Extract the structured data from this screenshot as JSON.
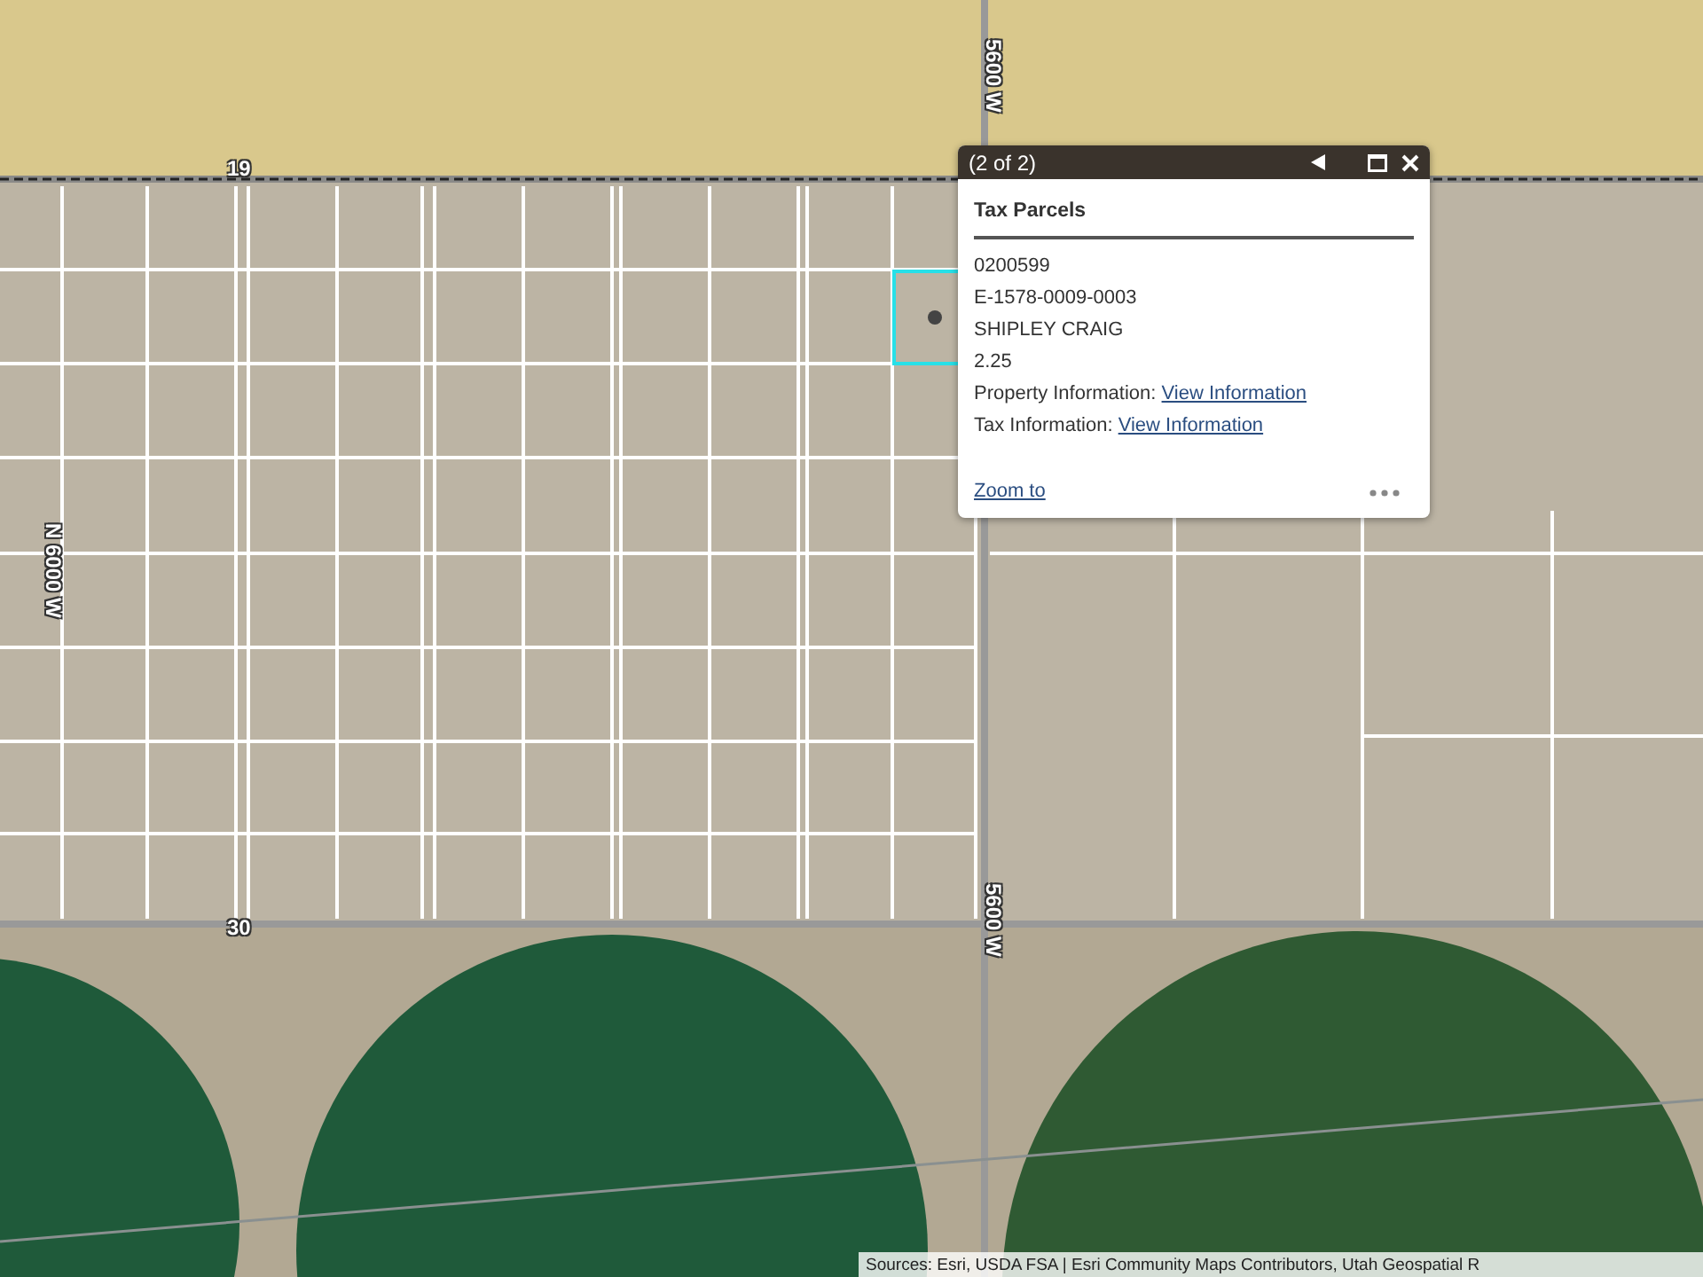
{
  "map": {
    "road_labels": [
      {
        "text": "19",
        "vertical": false
      },
      {
        "text": "5600 W",
        "vertical": true
      },
      {
        "text": "N 6000 W",
        "vertical": true
      },
      {
        "text": "30",
        "vertical": false
      },
      {
        "text": "5600 W",
        "vertical": true
      }
    ],
    "selected_parcel": true
  },
  "popup": {
    "pager": "(2 of 2)",
    "title": "Tax Parcels",
    "lines": [
      "0200599",
      "E-1578-0009-0003",
      "SHIPLEY CRAIG",
      "2.25"
    ],
    "fields": [
      {
        "label": "Property Information:",
        "link": "View Information"
      },
      {
        "label": "Tax Information:",
        "link": "View Information"
      }
    ],
    "zoom_link": "Zoom to"
  },
  "attribution": "Sources: Esri, USDA FSA | Esri Community Maps Contributors, Utah Geospatial R"
}
